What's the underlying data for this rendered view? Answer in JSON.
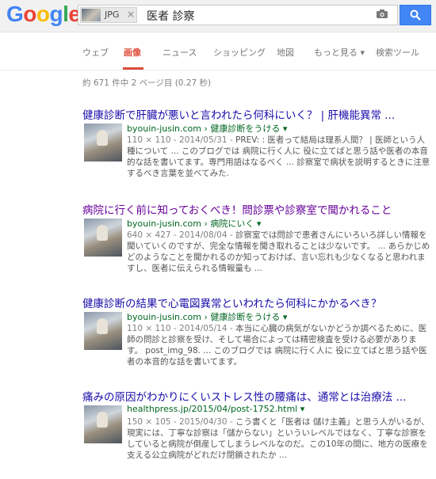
{
  "logo": {
    "letters": [
      "G",
      "o",
      "o",
      "g",
      "l",
      "e"
    ],
    "colors": [
      "#4285f4",
      "#ea4335",
      "#fbbc05",
      "#4285f4",
      "#34a853",
      "#ea4335"
    ]
  },
  "search": {
    "chip_label": "JPG",
    "chip_close": "×",
    "query": "医者 診察"
  },
  "tabs": [
    "ウェブ",
    "画像",
    "ニュース",
    "ショッピング",
    "地図",
    "もっと見る ▾",
    "検索ツール"
  ],
  "stats": "約 671 件中 2 ページ目 (0.27 秒)",
  "results": [
    {
      "title": "健康診断で肝臓が悪いと言われたら何科にいく？ | 肝機能異常 ...",
      "url": "byouin-jusin.com › 健康診断をうける ▾",
      "meta": "110 × 110 - 2014/05/31 - ",
      "desc": "PREV: : 医者って結局は理系人間？ | 医師という人種について ... このブログでは 病院に行く人に 役に立てばと思う話や医者の本音的な話を書いてます。専門用語はなるべく ... 診察室で病状を説明するときに注意するべき言葉を並べてみた."
    },
    {
      "title": "病院に行く前に知っておくべき！問診票や診察室で聞かれること",
      "url": "byouin-jusin.com › 病院にいく ▾",
      "meta": "640 × 427 - 2014/08/04 - ",
      "desc": "診察室では問診で患者さんにいろいろ詳しい情報を聞いていくのですが、完全な情報を聞き取れることは少ないです。 ... あらかじめどのようなことを聞かれるのか知っておけば、言い忘れも少なくなると思われますし、医者に伝えられる情報量も ..."
    },
    {
      "title": "健康診断の結果で心電図異常といわれたら何科にかかるべき？",
      "url": "byouin-jusin.com › 健康診断をうける ▾",
      "meta": "110 × 110 - 2014/05/14 - ",
      "desc": "本当に心臓の病気がないかどうか調べるために、医師の問診と診察を受け、そして場合によっては精密検査を受ける必要があります。 post_img_98. ... このブログでは 病院に行く人に 役に立てばと思う話や医者の本音的な話を書いてます。"
    },
    {
      "title": "痛みの原因がわかりにくいストレス性の腰痛は、通常とは治療法 ...",
      "url": "healthpress.jp/2015/04/post-1752.html ▾",
      "meta": "150 × 105 - 2015/04/30 - ",
      "desc": "こう書くと「医者は 儲け主義」と思う人がいるが、現実には、丁寧な診察は「儲からない」といういレベルではなく、丁寧な診察をしていると病院が倒産してしまうレベルなのだ。この10年の間に、地方の医療を支える公立病院がどれだけ閉鎖されたか ..."
    }
  ]
}
